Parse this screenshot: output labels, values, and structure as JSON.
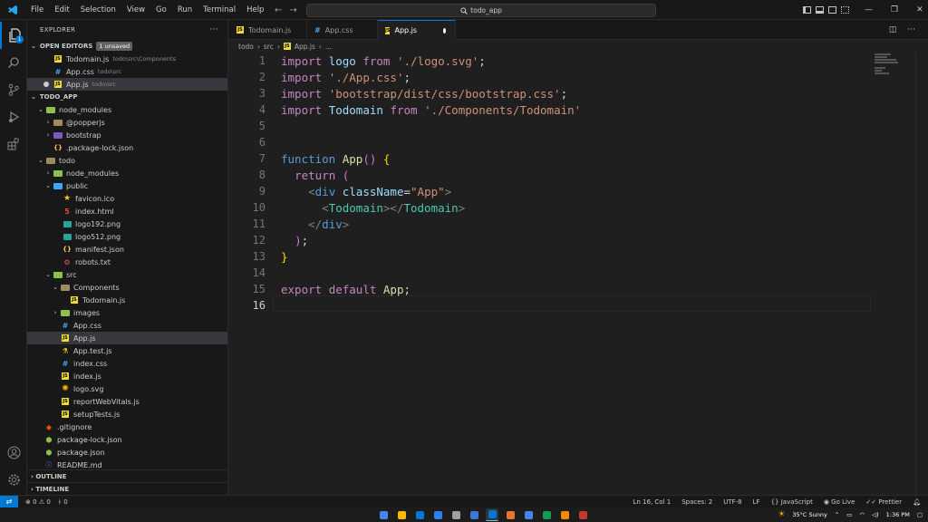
{
  "menu": [
    "File",
    "Edit",
    "Selection",
    "View",
    "Go",
    "Run",
    "Terminal",
    "Help"
  ],
  "command_center": {
    "text": "todo_app"
  },
  "window_controls": {
    "minimize": "—",
    "restore": "❐",
    "close": "✕"
  },
  "activity": {
    "explorer_badge": "1"
  },
  "sidebar": {
    "title": "EXPLORER",
    "more": "···",
    "open_editors": {
      "label": "OPEN EDITORS",
      "badge": "1 unsaved"
    },
    "open_files": [
      {
        "name": "Todomain.js",
        "path": "todo\\src\\Components"
      },
      {
        "name": "App.css",
        "path": "todo\\src"
      },
      {
        "name": "App.js",
        "path": "todo\\src"
      }
    ],
    "workspace": "TODO_APP",
    "tree": [
      "node_modules",
      "@popperjs",
      "bootstrap",
      ".package-lock.json",
      "todo",
      "node_modules",
      "public",
      "favicon.ico",
      "index.html",
      "logo192.png",
      "logo512.png",
      "manifest.json",
      "robots.txt",
      "src",
      "Components",
      "Todomain.js",
      "images",
      "App.css",
      "App.js",
      "App.test.js",
      "index.css",
      "index.js",
      "logo.svg",
      "reportWebVitals.js",
      "setupTests.js",
      ".gitignore",
      "package-lock.json",
      "package.json",
      "README.md"
    ],
    "outline": "OUTLINE",
    "timeline": "TIMELINE"
  },
  "tabs": [
    {
      "label": "Todomain.js"
    },
    {
      "label": "App.css"
    },
    {
      "label": "App.js"
    }
  ],
  "breadcrumb": [
    "todo",
    "src",
    "App.js",
    "..."
  ],
  "editor": {
    "line_numbers": [
      "1",
      "2",
      "3",
      "4",
      "5",
      "6",
      "7",
      "8",
      "9",
      "10",
      "11",
      "12",
      "13",
      "14",
      "15",
      "16"
    ],
    "l1": {
      "kw": "import",
      "id": "logo",
      "from": "from",
      "str": "'./logo.svg'",
      "end": ";"
    },
    "l2": {
      "kw": "import",
      "str": "'./App.css'",
      "end": ";"
    },
    "l3": {
      "kw": "import",
      "str": "'bootstrap/dist/css/bootstrap.css'",
      "end": ";"
    },
    "l4": {
      "kw": "import",
      "id": "Todomain",
      "from": "from",
      "str": "'./Components/Todomain'"
    },
    "l7": {
      "kw": "function",
      "fn": "App",
      "paren": "()",
      "brace": "{"
    },
    "l8": {
      "kw": "return",
      "paren": "("
    },
    "l9": {
      "open": "<",
      "tag": "div",
      "attr": "className",
      "eq": "=",
      "str": "\"App\"",
      "close": ">"
    },
    "l10": {
      "open": "<",
      "comp": "Todomain",
      "mid": "></",
      "comp2": "Todomain",
      "close": ">"
    },
    "l11": {
      "open": "</",
      "tag": "div",
      "close": ">"
    },
    "l12": {
      "paren": ")",
      "end": ";"
    },
    "l13": {
      "brace": "}"
    },
    "l15": {
      "kw": "export",
      "kw2": "default",
      "fn": "App",
      "end": ";"
    }
  },
  "status": {
    "errors": "0",
    "warnings": "0",
    "ports": "0",
    "position": "Ln 16, Col 1",
    "spaces": "Spaces: 2",
    "encoding": "UTF-8",
    "eol": "LF",
    "language": "JavaScript",
    "golive": "Go Live",
    "prettier": "Prettier"
  },
  "taskbar": {
    "weather": "35°C  Sunny",
    "time": "1:36 PM",
    "app_colors": [
      "#4285f4",
      "#ffb900",
      "#0078d4",
      "#2f80ed",
      "#a0a0a0",
      "#3c78d8",
      "#0078d4",
      "#e8772e",
      "#4285f4",
      "#0f9d58",
      "#ff8800",
      "#c0392b"
    ]
  }
}
